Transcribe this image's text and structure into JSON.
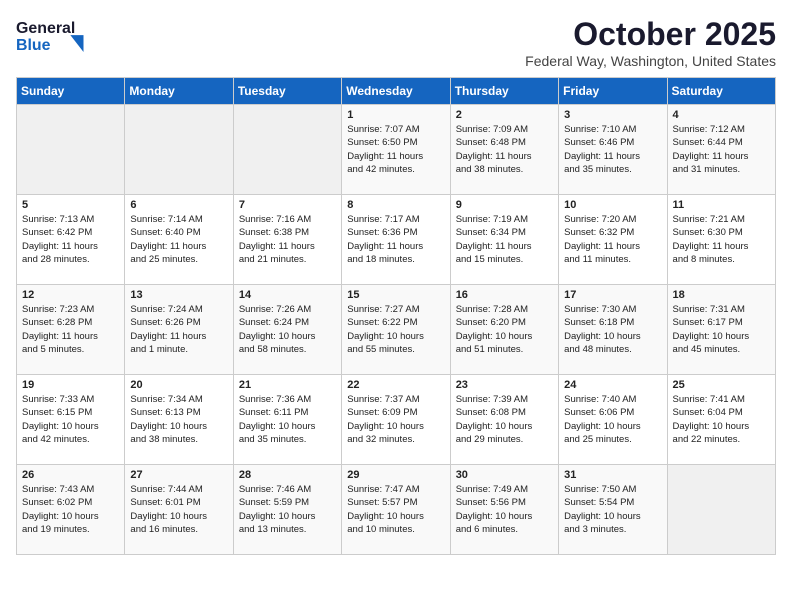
{
  "header": {
    "logo_line1": "General",
    "logo_line2": "Blue",
    "month": "October 2025",
    "location": "Federal Way, Washington, United States"
  },
  "days_of_week": [
    "Sunday",
    "Monday",
    "Tuesday",
    "Wednesday",
    "Thursday",
    "Friday",
    "Saturday"
  ],
  "weeks": [
    [
      {
        "num": "",
        "info": ""
      },
      {
        "num": "",
        "info": ""
      },
      {
        "num": "",
        "info": ""
      },
      {
        "num": "1",
        "info": "Sunrise: 7:07 AM\nSunset: 6:50 PM\nDaylight: 11 hours\nand 42 minutes."
      },
      {
        "num": "2",
        "info": "Sunrise: 7:09 AM\nSunset: 6:48 PM\nDaylight: 11 hours\nand 38 minutes."
      },
      {
        "num": "3",
        "info": "Sunrise: 7:10 AM\nSunset: 6:46 PM\nDaylight: 11 hours\nand 35 minutes."
      },
      {
        "num": "4",
        "info": "Sunrise: 7:12 AM\nSunset: 6:44 PM\nDaylight: 11 hours\nand 31 minutes."
      }
    ],
    [
      {
        "num": "5",
        "info": "Sunrise: 7:13 AM\nSunset: 6:42 PM\nDaylight: 11 hours\nand 28 minutes."
      },
      {
        "num": "6",
        "info": "Sunrise: 7:14 AM\nSunset: 6:40 PM\nDaylight: 11 hours\nand 25 minutes."
      },
      {
        "num": "7",
        "info": "Sunrise: 7:16 AM\nSunset: 6:38 PM\nDaylight: 11 hours\nand 21 minutes."
      },
      {
        "num": "8",
        "info": "Sunrise: 7:17 AM\nSunset: 6:36 PM\nDaylight: 11 hours\nand 18 minutes."
      },
      {
        "num": "9",
        "info": "Sunrise: 7:19 AM\nSunset: 6:34 PM\nDaylight: 11 hours\nand 15 minutes."
      },
      {
        "num": "10",
        "info": "Sunrise: 7:20 AM\nSunset: 6:32 PM\nDaylight: 11 hours\nand 11 minutes."
      },
      {
        "num": "11",
        "info": "Sunrise: 7:21 AM\nSunset: 6:30 PM\nDaylight: 11 hours\nand 8 minutes."
      }
    ],
    [
      {
        "num": "12",
        "info": "Sunrise: 7:23 AM\nSunset: 6:28 PM\nDaylight: 11 hours\nand 5 minutes."
      },
      {
        "num": "13",
        "info": "Sunrise: 7:24 AM\nSunset: 6:26 PM\nDaylight: 11 hours\nand 1 minute."
      },
      {
        "num": "14",
        "info": "Sunrise: 7:26 AM\nSunset: 6:24 PM\nDaylight: 10 hours\nand 58 minutes."
      },
      {
        "num": "15",
        "info": "Sunrise: 7:27 AM\nSunset: 6:22 PM\nDaylight: 10 hours\nand 55 minutes."
      },
      {
        "num": "16",
        "info": "Sunrise: 7:28 AM\nSunset: 6:20 PM\nDaylight: 10 hours\nand 51 minutes."
      },
      {
        "num": "17",
        "info": "Sunrise: 7:30 AM\nSunset: 6:18 PM\nDaylight: 10 hours\nand 48 minutes."
      },
      {
        "num": "18",
        "info": "Sunrise: 7:31 AM\nSunset: 6:17 PM\nDaylight: 10 hours\nand 45 minutes."
      }
    ],
    [
      {
        "num": "19",
        "info": "Sunrise: 7:33 AM\nSunset: 6:15 PM\nDaylight: 10 hours\nand 42 minutes."
      },
      {
        "num": "20",
        "info": "Sunrise: 7:34 AM\nSunset: 6:13 PM\nDaylight: 10 hours\nand 38 minutes."
      },
      {
        "num": "21",
        "info": "Sunrise: 7:36 AM\nSunset: 6:11 PM\nDaylight: 10 hours\nand 35 minutes."
      },
      {
        "num": "22",
        "info": "Sunrise: 7:37 AM\nSunset: 6:09 PM\nDaylight: 10 hours\nand 32 minutes."
      },
      {
        "num": "23",
        "info": "Sunrise: 7:39 AM\nSunset: 6:08 PM\nDaylight: 10 hours\nand 29 minutes."
      },
      {
        "num": "24",
        "info": "Sunrise: 7:40 AM\nSunset: 6:06 PM\nDaylight: 10 hours\nand 25 minutes."
      },
      {
        "num": "25",
        "info": "Sunrise: 7:41 AM\nSunset: 6:04 PM\nDaylight: 10 hours\nand 22 minutes."
      }
    ],
    [
      {
        "num": "26",
        "info": "Sunrise: 7:43 AM\nSunset: 6:02 PM\nDaylight: 10 hours\nand 19 minutes."
      },
      {
        "num": "27",
        "info": "Sunrise: 7:44 AM\nSunset: 6:01 PM\nDaylight: 10 hours\nand 16 minutes."
      },
      {
        "num": "28",
        "info": "Sunrise: 7:46 AM\nSunset: 5:59 PM\nDaylight: 10 hours\nand 13 minutes."
      },
      {
        "num": "29",
        "info": "Sunrise: 7:47 AM\nSunset: 5:57 PM\nDaylight: 10 hours\nand 10 minutes."
      },
      {
        "num": "30",
        "info": "Sunrise: 7:49 AM\nSunset: 5:56 PM\nDaylight: 10 hours\nand 6 minutes."
      },
      {
        "num": "31",
        "info": "Sunrise: 7:50 AM\nSunset: 5:54 PM\nDaylight: 10 hours\nand 3 minutes."
      },
      {
        "num": "",
        "info": ""
      }
    ]
  ]
}
